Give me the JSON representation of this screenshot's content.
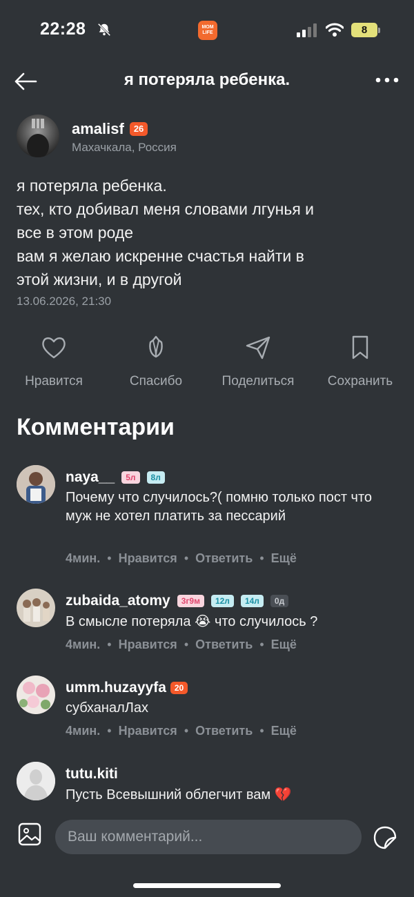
{
  "status_bar": {
    "time": "22:28",
    "app_logo": "MOM LIFE",
    "battery": "8"
  },
  "header": {
    "title": "я потеряла ребенка."
  },
  "author": {
    "name": "amalisf",
    "badge": "26",
    "location": "Махачкала, Россия"
  },
  "post": {
    "lines": [
      "я потеряла ребенка.",
      "тех, кто добивал меня словами лгунья и",
      "все в этом роде",
      "вам я желаю искренне счастья найти в",
      "этой жизни, и в другой"
    ],
    "date": "13.06.2026, 21:30"
  },
  "actions": {
    "like": "Нравится",
    "thanks": "Спасибо",
    "share": "Поделиться",
    "save": "Сохранить"
  },
  "comments_heading": "Комментарии",
  "comments": [
    {
      "name": "naya__",
      "tags": [
        "5л",
        "8л"
      ],
      "text": "Почему что случилось?( помню только пост что муж не хотел платить за пессарий",
      "time": "4мин.",
      "like": "Нравится",
      "reply": "Ответить",
      "more": "Ещё"
    },
    {
      "name": "zubaida_atomy",
      "tags": [
        "3г9м",
        "12л",
        "14л",
        "0д"
      ],
      "text": "В смысле потеряла 😭 что случилось ?",
      "time": "4мин.",
      "like": "Нравится",
      "reply": "Ответить",
      "more": "Ещё"
    },
    {
      "name": "umm.huzayyfa",
      "tags": [
        "20"
      ],
      "text": "субханалЛах",
      "time": "4мин.",
      "like": "Нравится",
      "reply": "Ответить",
      "more": "Ещё"
    },
    {
      "name": "tutu.kiti",
      "tags": [],
      "text": "Пусть Всевышний облегчит вам 💔",
      "time": "",
      "like": "",
      "reply": "",
      "more": ""
    }
  ],
  "composer": {
    "placeholder": "Ваш комментарий..."
  },
  "colors": {
    "background": "#2f3337",
    "accent": "#f4592a",
    "muted": "#8b9096"
  }
}
